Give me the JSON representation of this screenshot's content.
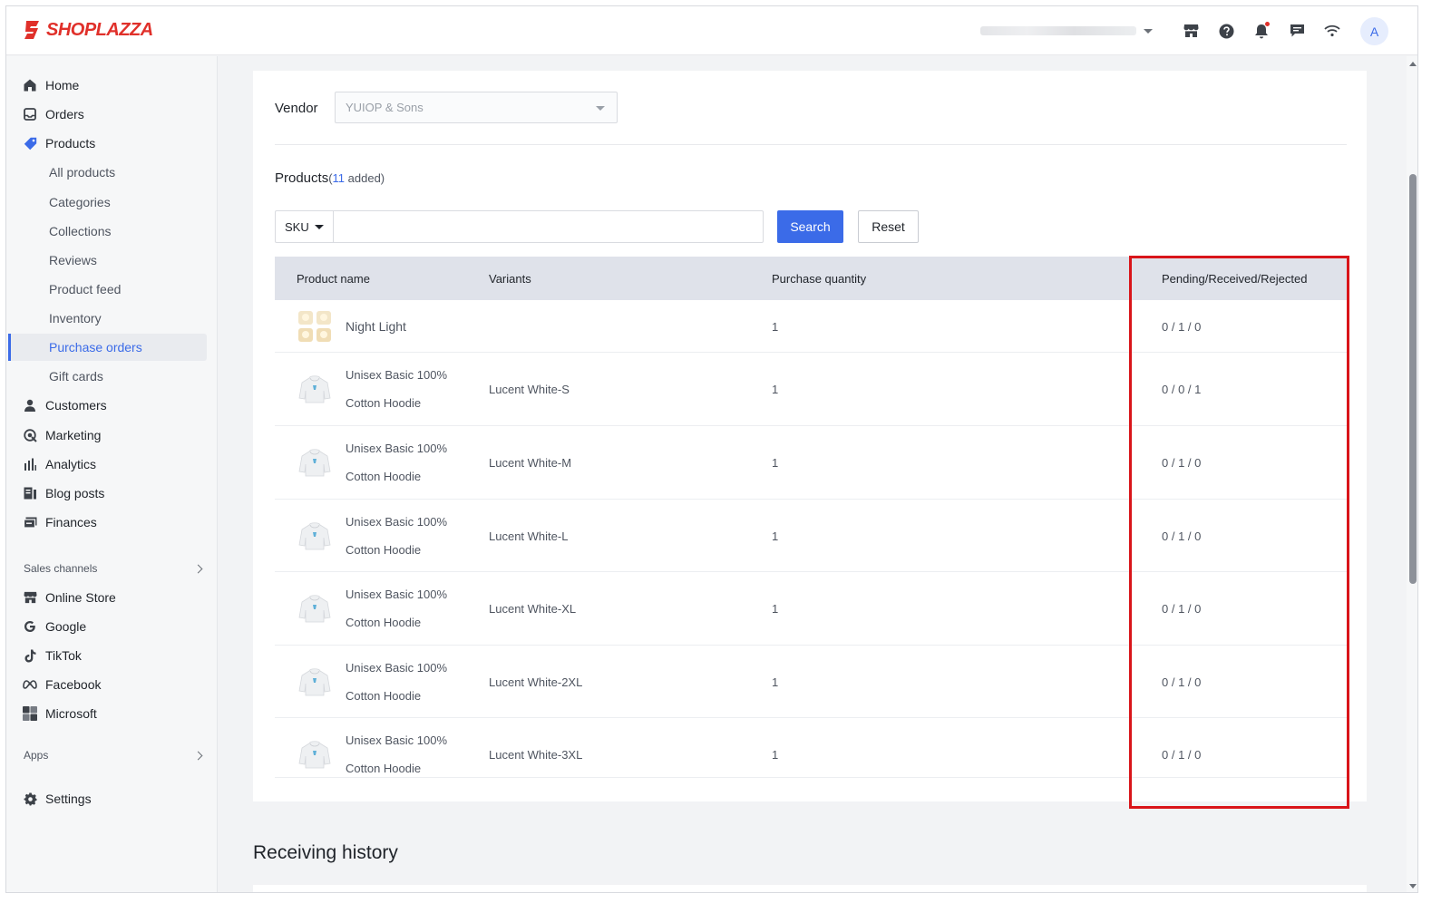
{
  "brand": {
    "name": "SHOPLAZZA",
    "color": "#e0302a",
    "accent": "#3b6be8"
  },
  "header": {
    "icons": [
      "store-icon",
      "help-icon",
      "bell-icon",
      "message-icon",
      "wifi-icon"
    ],
    "avatar_initial": "A"
  },
  "sidebar": {
    "main_items": [
      {
        "label": "Home",
        "icon": "home-icon"
      },
      {
        "label": "Orders",
        "icon": "orders-icon"
      },
      {
        "label": "Products",
        "icon": "tag-icon"
      }
    ],
    "product_sub_items": [
      {
        "label": "All products"
      },
      {
        "label": "Categories"
      },
      {
        "label": "Collections"
      },
      {
        "label": "Reviews"
      },
      {
        "label": "Product feed"
      },
      {
        "label": "Inventory"
      },
      {
        "label": "Purchase orders",
        "active": true
      },
      {
        "label": "Gift cards"
      }
    ],
    "more_items": [
      {
        "label": "Customers",
        "icon": "person-icon"
      },
      {
        "label": "Marketing",
        "icon": "marketing-icon"
      },
      {
        "label": "Analytics",
        "icon": "analytics-icon"
      },
      {
        "label": "Blog posts",
        "icon": "blog-icon"
      },
      {
        "label": "Finances",
        "icon": "finance-icon"
      }
    ],
    "sales_channels_label": "Sales channels",
    "channels": [
      {
        "label": "Online Store",
        "icon": "store-icon"
      },
      {
        "label": "Google",
        "icon": "google-icon"
      },
      {
        "label": "TikTok",
        "icon": "tiktok-icon"
      },
      {
        "label": "Facebook",
        "icon": "meta-icon"
      },
      {
        "label": "Microsoft",
        "icon": "microsoft-icon"
      }
    ],
    "apps_label": "Apps",
    "settings_label": "Settings"
  },
  "form": {
    "vendor_label": "Vendor",
    "vendor_value": "YUIOP & Sons",
    "products_label": "Products",
    "products_count": "11",
    "products_added": " added)",
    "products_open": "(",
    "sku_label": "SKU",
    "search_value": "",
    "search_button": "Search",
    "reset_button": "Reset"
  },
  "table": {
    "columns": [
      "Product name",
      "Variants",
      "Purchase quantity",
      "Pending/Received/Rejected"
    ],
    "rows": [
      {
        "name_line1": "Night Light",
        "name_line2": "",
        "variant": "",
        "quantity": "1",
        "status": "0 / 1 / 0",
        "thumb": "night-light-thumbnail"
      },
      {
        "name_line1": "Unisex Basic 100%",
        "name_line2": "Cotton Hoodie",
        "variant": "Lucent White-S",
        "quantity": "1",
        "status": "0 / 0 / 1",
        "thumb": "hoodie-thumbnail"
      },
      {
        "name_line1": "Unisex Basic 100%",
        "name_line2": "Cotton Hoodie",
        "variant": "Lucent White-M",
        "quantity": "1",
        "status": "0 / 1 / 0",
        "thumb": "hoodie-thumbnail"
      },
      {
        "name_line1": "Unisex Basic 100%",
        "name_line2": "Cotton Hoodie",
        "variant": "Lucent White-L",
        "quantity": "1",
        "status": "0 / 1 / 0",
        "thumb": "hoodie-thumbnail"
      },
      {
        "name_line1": "Unisex Basic 100%",
        "name_line2": "Cotton Hoodie",
        "variant": "Lucent White-XL",
        "quantity": "1",
        "status": "0 / 1 / 0",
        "thumb": "hoodie-thumbnail"
      },
      {
        "name_line1": "Unisex Basic 100%",
        "name_line2": "Cotton Hoodie",
        "variant": "Lucent White-2XL",
        "quantity": "1",
        "status": "0 / 1 / 0",
        "thumb": "hoodie-thumbnail"
      },
      {
        "name_line1": "Unisex Basic 100%",
        "name_line2": "Cotton Hoodie",
        "variant": "Lucent White-3XL",
        "quantity": "1",
        "status": "0 / 1 / 0",
        "thumb": "hoodie-thumbnail"
      }
    ]
  },
  "receiving_history": {
    "title": "Receiving history"
  },
  "highlight_color": "#d9151a"
}
